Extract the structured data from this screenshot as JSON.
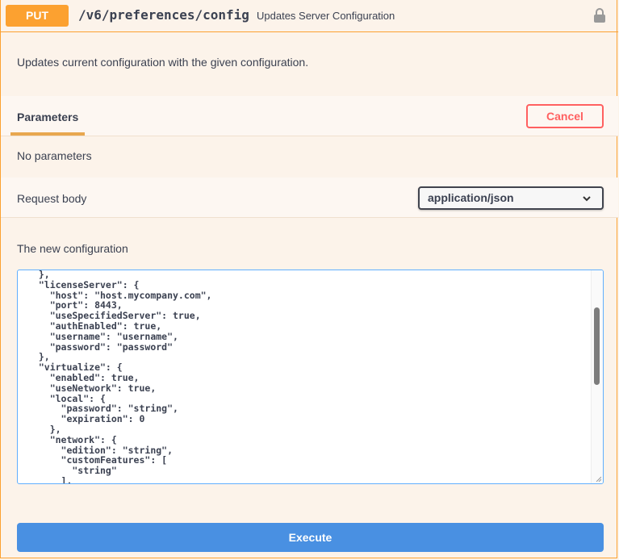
{
  "summary": {
    "method": "PUT",
    "path": "/v6/preferences/config",
    "description": "Updates Server Configuration",
    "lock_icon": "lock-icon"
  },
  "description": "Updates current configuration with the given configuration.",
  "parameters": {
    "tab_label": "Parameters",
    "cancel_label": "Cancel",
    "empty_text": "No parameters"
  },
  "request_body": {
    "label": "Request body",
    "content_type": "application/json",
    "body_label": "The new configuration",
    "code": "  },\n  \"licenseServer\": {\n    \"host\": \"host.mycompany.com\",\n    \"port\": 8443,\n    \"useSpecifiedServer\": true,\n    \"authEnabled\": true,\n    \"username\": \"username\",\n    \"password\": \"password\"\n  },\n  \"virtualize\": {\n    \"enabled\": true,\n    \"useNetwork\": true,\n    \"local\": {\n      \"password\": \"string\",\n      \"expiration\": 0\n    },\n    \"network\": {\n      \"edition\": \"string\",\n      \"customFeatures\": [\n        \"string\"\n      ],"
  },
  "execute_label": "Execute",
  "colors": {
    "method": "#fca130",
    "cancel": "#ff6060",
    "execute": "#4990e2",
    "focus": "#61affe"
  }
}
